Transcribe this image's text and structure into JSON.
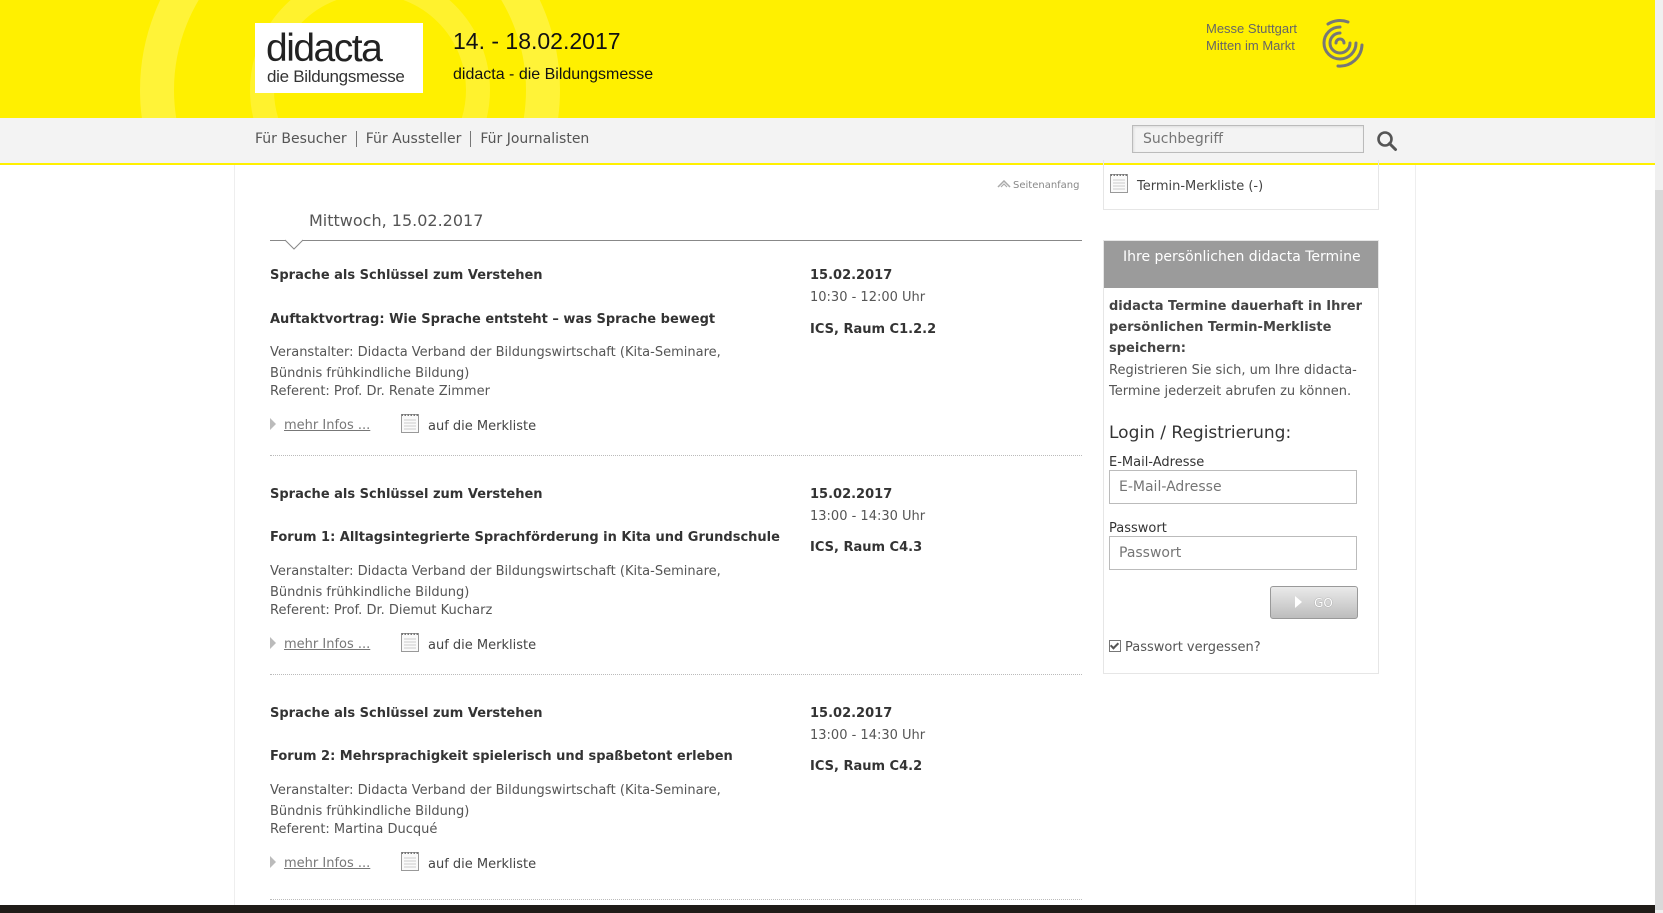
{
  "header": {
    "logo_main": "didacta",
    "logo_sub": "die Bildungsmesse",
    "event_dates": "14. - 18.02.2017",
    "event_name": "didacta - die Bildungsmesse",
    "messe_line1": "Messe Stuttgart",
    "messe_line2": "Mitten im Markt",
    "messe_logo_icon": "swirl-logo-icon"
  },
  "nav": {
    "items": [
      "Für Besucher",
      "Für Aussteller",
      "Für Journalisten"
    ],
    "search_placeholder": "Suchbegriff",
    "search_icon": "magnifier-icon"
  },
  "main": {
    "to_top": "Seitenanfang",
    "day_heading": "Mittwoch, 15.02.2017",
    "more_label": "mehr Infos ...",
    "notelist_label": "auf die Merkliste",
    "events": [
      {
        "series": "Sprache als Schlüssel zum Verstehen",
        "title": "Auftaktvortrag: Wie Sprache entsteht – was Sprache bewegt",
        "organizer": "Veranstalter: Didacta Verband der Bildungswirtschaft (Kita-Seminare, Bündnis frühkindliche Bildung)",
        "referent": "Referent: Prof. Dr. Renate Zimmer",
        "date": "15.02.2017",
        "time": "10:30 - 12:00 Uhr",
        "room": "ICS, Raum C1.2.2"
      },
      {
        "series": "Sprache als Schlüssel zum Verstehen",
        "title": "Forum 1: Alltagsintegrierte Sprachförderung in Kita und Grundschule",
        "organizer": "Veranstalter: Didacta Verband der Bildungswirtschaft (Kita-Seminare, Bündnis frühkindliche Bildung)",
        "referent": "Referent: Prof. Dr. Diemut Kucharz",
        "date": "15.02.2017",
        "time": "13:00 - 14:30 Uhr",
        "room": "ICS, Raum C4.3"
      },
      {
        "series": "Sprache als Schlüssel zum Verstehen",
        "title": "Forum 2: Mehrsprachigkeit spielerisch und spaßbetont erleben",
        "organizer": "Veranstalter: Didacta Verband der Bildungswirtschaft (Kita-Seminare, Bündnis frühkindliche Bildung)",
        "referent": "Referent: Martina Ducqué",
        "date": "15.02.2017",
        "time": "13:00 - 14:30 Uhr",
        "room": "ICS, Raum C4.2"
      }
    ]
  },
  "sidebar": {
    "merkliste_label": "Termin-Merkliste (-)",
    "box_title": "Ihre persönlichen didacta Termine",
    "lead": "didacta Termine dauerhaft in Ihrer persönlichen Termin-Merkliste speichern:",
    "info": "Registrieren Sie sich, um Ihre didacta-Termine jederzeit abrufen zu können.",
    "login_heading": "Login / Registrierung:",
    "email_label": "E-Mail-Adresse",
    "email_placeholder": "E-Mail-Adresse",
    "password_label": "Passwort",
    "password_placeholder": "Passwort",
    "go_label": "GO",
    "forgot_label": "Passwort vergessen?"
  },
  "colors": {
    "brand_yellow": "#fff000",
    "nav_bg": "#f3f3f3",
    "sidebar_head": "#9b9b9b"
  }
}
